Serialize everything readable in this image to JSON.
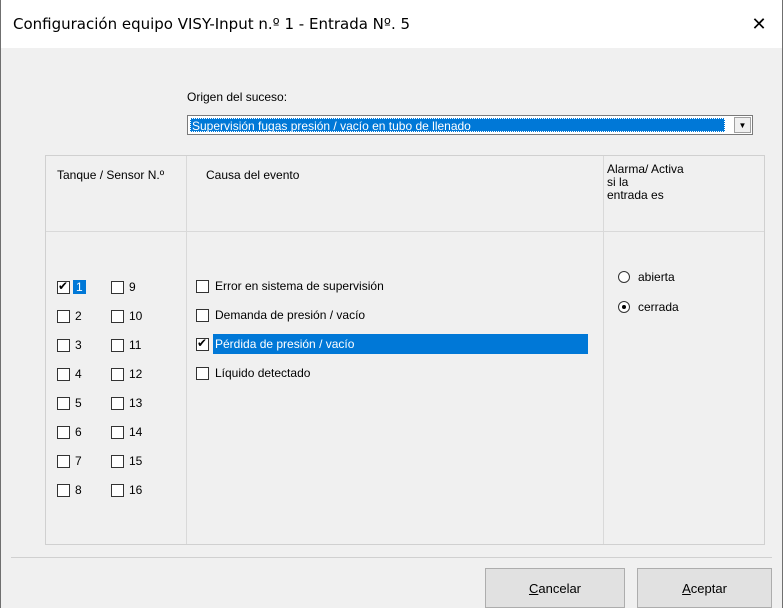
{
  "window": {
    "title": "Configuración equipo VISY-Input n.º 1 - Entrada Nº. 5",
    "close_glyph": "✕"
  },
  "origin": {
    "label": "Origen del suceso:",
    "selected": "Supervisión fugas presión / vacío en tubo de llenado",
    "arrow_glyph": "▼"
  },
  "headers": {
    "sensor": "Tanque / Sensor N.º",
    "cause": "Causa del evento",
    "alarm_line1": "Alarma/ Activa",
    "alarm_line2": "si la",
    "alarm_line3": "entrada  es"
  },
  "sensors": [
    {
      "label": "1",
      "checked": true,
      "selected": true
    },
    {
      "label": "2",
      "checked": false
    },
    {
      "label": "3",
      "checked": false
    },
    {
      "label": "4",
      "checked": false
    },
    {
      "label": "5",
      "checked": false
    },
    {
      "label": "6",
      "checked": false
    },
    {
      "label": "7",
      "checked": false
    },
    {
      "label": "8",
      "checked": false
    },
    {
      "label": "9",
      "checked": false
    },
    {
      "label": "10",
      "checked": false
    },
    {
      "label": "11",
      "checked": false
    },
    {
      "label": "12",
      "checked": false
    },
    {
      "label": "13",
      "checked": false
    },
    {
      "label": "14",
      "checked": false
    },
    {
      "label": "15",
      "checked": false
    },
    {
      "label": "16",
      "checked": false
    }
  ],
  "causes": [
    {
      "label": "Error en sistema de supervisión",
      "checked": false
    },
    {
      "label": "Demanda de presión / vacío",
      "checked": false
    },
    {
      "label": "Pérdida de presión / vacío",
      "checked": true,
      "selected": true
    },
    {
      "label": "Líquido detectado",
      "checked": false
    }
  ],
  "alarm": {
    "open_label": "abierta",
    "closed_label": "cerrada",
    "selected": "cerrada"
  },
  "buttons": {
    "cancel_mnemonic": "C",
    "cancel_rest": "ancelar",
    "accept_mnemonic": "A",
    "accept_rest": "ceptar"
  }
}
